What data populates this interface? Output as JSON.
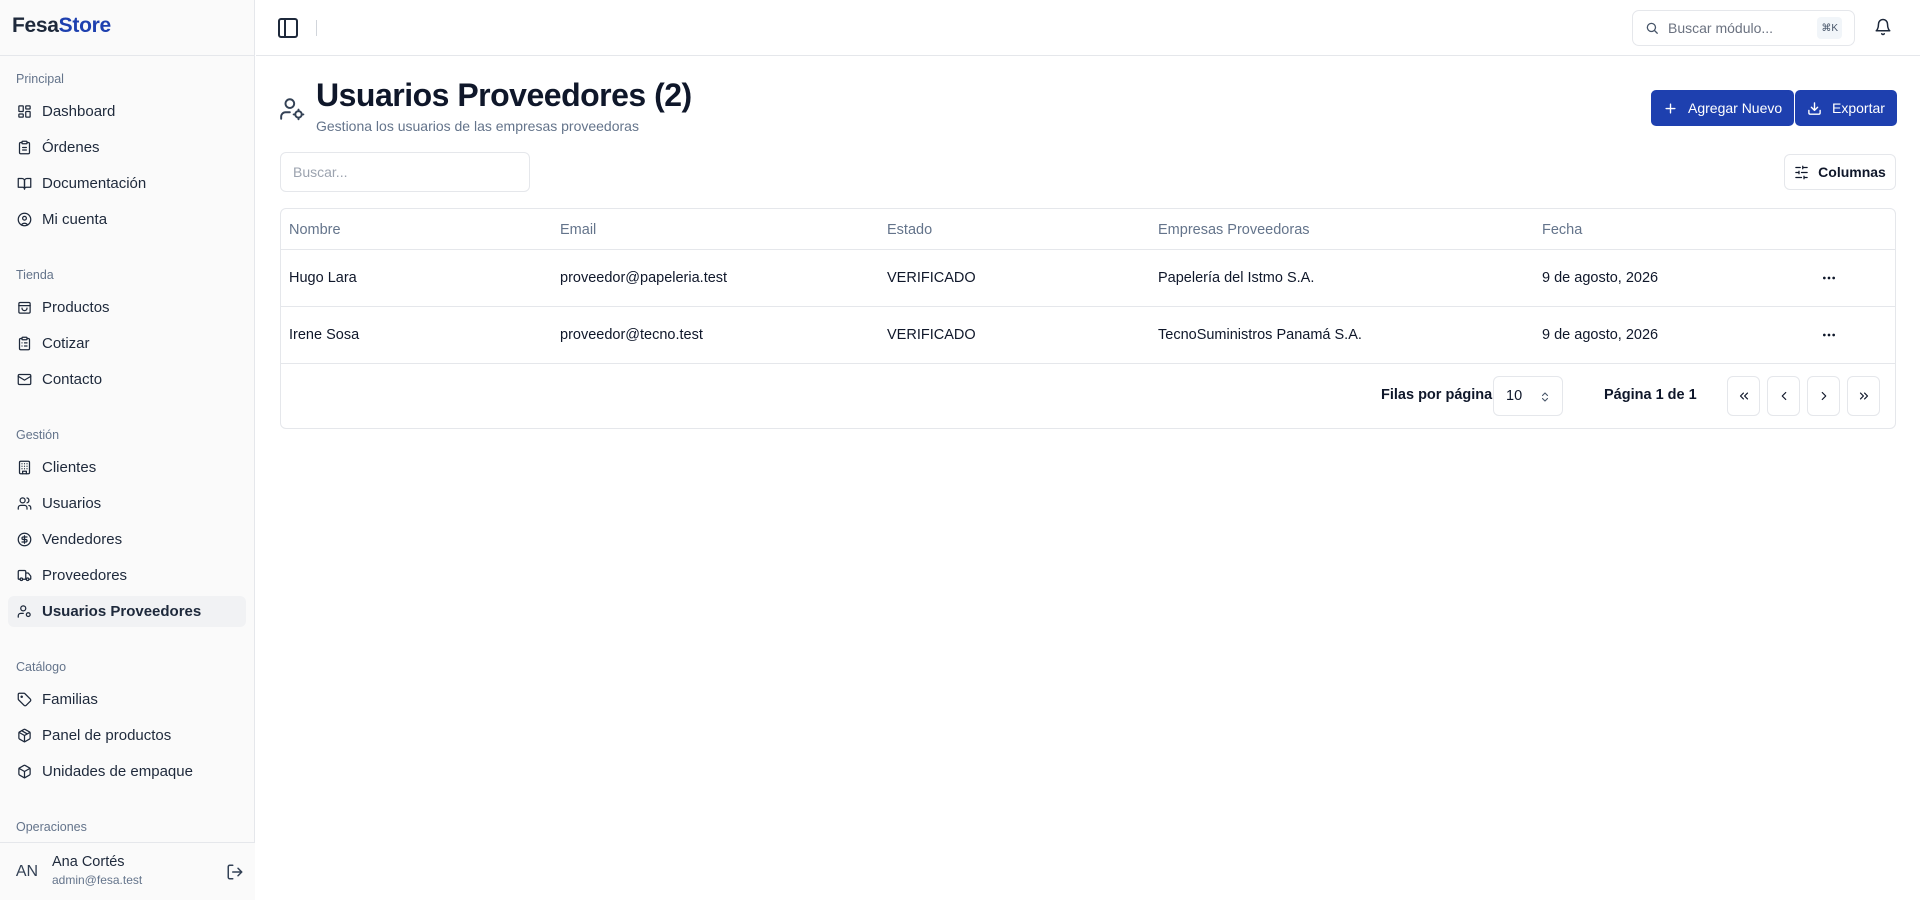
{
  "brand": {
    "part1": "Fesa",
    "part2": "Store"
  },
  "sidebar": {
    "sections": [
      {
        "label": "Principal",
        "items": [
          {
            "label": "Dashboard",
            "icon": "dashboard-icon"
          },
          {
            "label": "Órdenes",
            "icon": "clipboard-icon"
          },
          {
            "label": "Documentación",
            "icon": "book-icon"
          },
          {
            "label": "Mi cuenta",
            "icon": "user-circle-icon"
          }
        ]
      },
      {
        "label": "Tienda",
        "items": [
          {
            "label": "Productos",
            "icon": "shopping-bag-icon"
          },
          {
            "label": "Cotizar",
            "icon": "clipboard-list-icon"
          },
          {
            "label": "Contacto",
            "icon": "mail-icon"
          }
        ]
      },
      {
        "label": "Gestión",
        "items": [
          {
            "label": "Clientes",
            "icon": "building-icon"
          },
          {
            "label": "Usuarios",
            "icon": "users-icon"
          },
          {
            "label": "Vendedores",
            "icon": "dollar-circle-icon"
          },
          {
            "label": "Proveedores",
            "icon": "truck-icon"
          },
          {
            "label": "Usuarios Proveedores",
            "icon": "user-cog-icon",
            "active": true
          }
        ]
      },
      {
        "label": "Catálogo",
        "items": [
          {
            "label": "Familias",
            "icon": "tag-icon"
          },
          {
            "label": "Panel de productos",
            "icon": "package-icon"
          },
          {
            "label": "Unidades de empaque",
            "icon": "box-icon"
          }
        ]
      },
      {
        "label": "Operaciones",
        "items": []
      }
    ],
    "user": {
      "initials": "AN",
      "name": "Ana Cortés",
      "email": "admin@fesa.test"
    }
  },
  "topbar": {
    "search_placeholder": "Buscar módulo...",
    "shortcut": "⌘K"
  },
  "header": {
    "title": "Usuarios Proveedores (2)",
    "subtitle": "Gestiona los usuarios de las empresas proveedoras",
    "add_label": "Agregar Nuevo",
    "export_label": "Exportar"
  },
  "filters": {
    "search_placeholder": "Buscar...",
    "columns_label": "Columnas"
  },
  "table": {
    "columns": [
      "Nombre",
      "Email",
      "Estado",
      "Empresas Proveedoras",
      "Fecha"
    ],
    "rows": [
      [
        "Hugo Lara",
        "proveedor@papeleria.test",
        "VERIFICADO",
        "Papelería del Istmo S.A.",
        "9 de agosto, 2026"
      ],
      [
        "Irene Sosa",
        "proveedor@tecno.test",
        "VERIFICADO",
        "TecnoSuministros Panamá S.A.",
        "9 de agosto, 2026"
      ]
    ]
  },
  "pagination": {
    "rows_label": "Filas por página",
    "rows_value": "10",
    "page_label": "Página 1 de 1"
  },
  "colors": {
    "accent": "#1e40af",
    "sidebar_bg": "#fafafa",
    "border": "#e5e7eb",
    "muted": "#64748b"
  }
}
